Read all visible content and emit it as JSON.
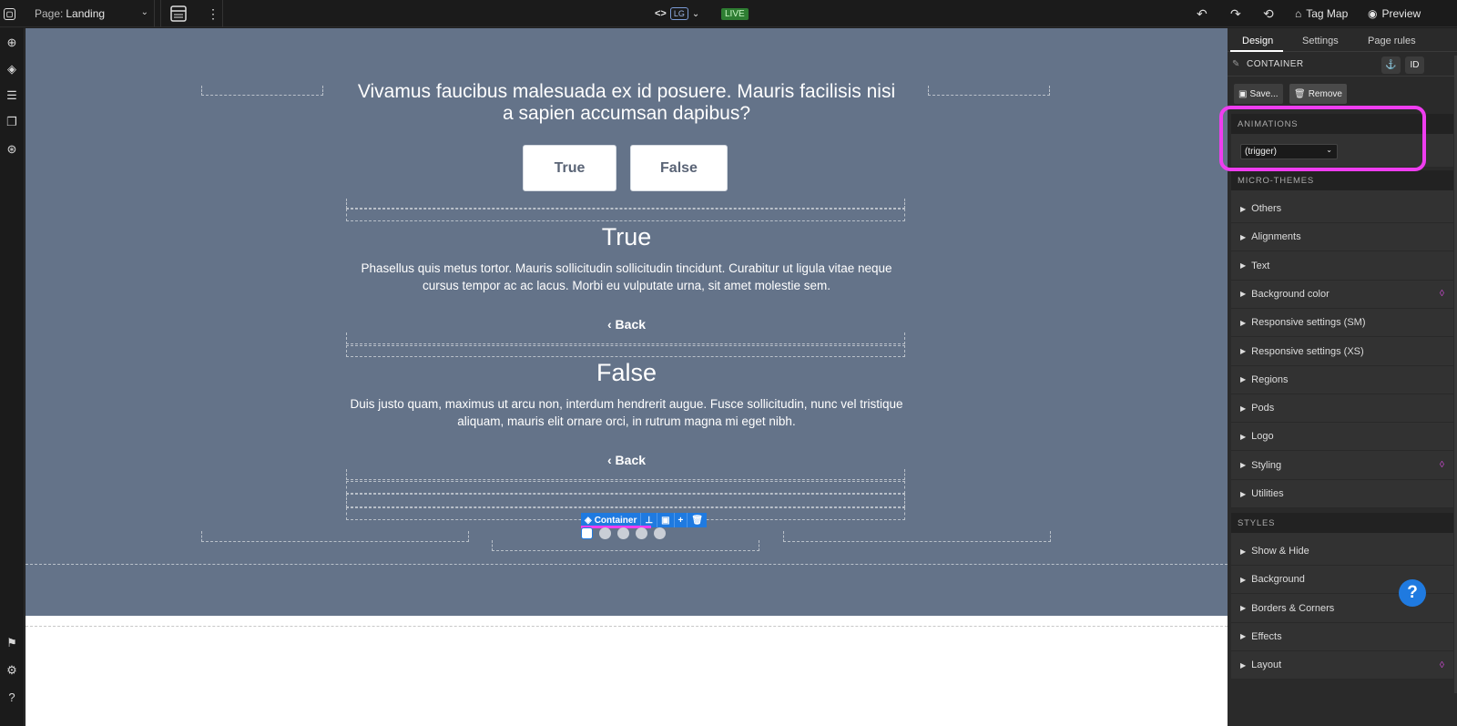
{
  "topbar": {
    "page_prefix": "Page:",
    "page_name": "Landing",
    "breakpoint": "LG",
    "live": "LIVE",
    "tag_map": "Tag Map",
    "preview": "Preview"
  },
  "canvas": {
    "question": "Vivamus faucibus malesuada ex id posuere. Mauris facilisis nisi a sapien accumsan dapibus?",
    "buttons": [
      "True",
      "False"
    ],
    "answers": [
      {
        "title": "True",
        "body": "Phasellus quis metus tortor. Mauris sollicitudin sollicitudin tincidunt. Curabitur ut ligula vitae neque cursus tempor ac ac lacus. Morbi eu vulputate urna, sit amet molestie sem.",
        "back": "Back"
      },
      {
        "title": "False",
        "body": "Duis justo quam, maximus ut arcu non, interdum hendrerit augue. Fusce sollicitudin, nunc vel tristique aliquam, mauris elit ornare orci, in rutrum magna mi eget nibh.",
        "back": "Back"
      }
    ],
    "container_label": "Container"
  },
  "panel": {
    "tabs": [
      "Design",
      "Settings",
      "Page rules"
    ],
    "selected_type": "CONTAINER",
    "id_btn": "ID",
    "save": "Save...",
    "remove": "Remove",
    "animations_header": "ANIMATIONS",
    "trigger": "(trigger)",
    "micro_header": "MICRO-THEMES",
    "micro_items": [
      {
        "label": "Others",
        "dot": false
      },
      {
        "label": "Alignments",
        "dot": false
      },
      {
        "label": "Text",
        "dot": false
      },
      {
        "label": "Background color",
        "dot": true
      },
      {
        "label": "Responsive settings (SM)",
        "dot": false
      },
      {
        "label": "Responsive settings (XS)",
        "dot": false
      },
      {
        "label": "Regions",
        "dot": false
      },
      {
        "label": "Pods",
        "dot": false
      },
      {
        "label": "Logo",
        "dot": false
      },
      {
        "label": "Styling",
        "dot": true
      },
      {
        "label": "Utilities",
        "dot": false
      }
    ],
    "styles_header": "STYLES",
    "style_items": [
      {
        "label": "Show & Hide",
        "dot": false
      },
      {
        "label": "Background",
        "dot": false
      },
      {
        "label": "Borders & Corners",
        "dot": false
      },
      {
        "label": "Effects",
        "dot": false
      },
      {
        "label": "Layout",
        "dot": true
      }
    ]
  },
  "colors": {
    "section_bg": "#647389",
    "accent": "#1f7ae0",
    "highlight": "#ef3df0"
  }
}
